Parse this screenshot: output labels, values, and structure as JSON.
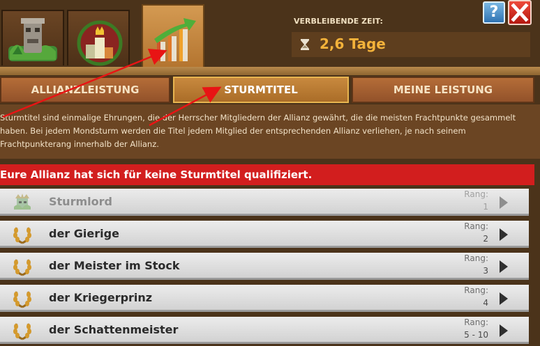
{
  "tabs_icons": [
    {
      "name": "alliance-performance-tab-icon"
    },
    {
      "name": "storm-titles-tab-icon"
    },
    {
      "name": "my-performance-tab-icon"
    }
  ],
  "time": {
    "label": "VERBLEIBENDE ZEIT:",
    "value": "2,6 Tage"
  },
  "tabs": [
    {
      "label": "ALLIANZLEISTUNG"
    },
    {
      "label": "STURMTITEL"
    },
    {
      "label": "MEINE LEISTUNG"
    }
  ],
  "description": "Sturmtitel sind einmalige Ehrungen, die der Herrscher Mitgliedern der Allianz gewährt, die die meisten Frachtpunkte gesammelt haben. Bei jedem Mondsturm werden die Titel jedem Mitglied der entsprechenden Allianz verliehen, je nach seinem Frachtpunkterang innerhalb der Allianz.",
  "banner": "Eure Allianz hat sich für keine Sturmtitel qualifiziert.",
  "rank_label": "Rang:",
  "titles": [
    {
      "name": "Sturmlord",
      "rank": "1"
    },
    {
      "name": "der Gierige",
      "rank": "2"
    },
    {
      "name": "der Meister im Stock",
      "rank": "3"
    },
    {
      "name": "der Kriegerprinz",
      "rank": "4"
    },
    {
      "name": "der Schattenmeister",
      "rank": "5 - 10"
    }
  ],
  "colors": {
    "background": "#4b331a",
    "banner": "#d21e1e",
    "time_value": "#f3b23a",
    "annotation_arrow": "#e81414"
  },
  "help_symbol": "?"
}
